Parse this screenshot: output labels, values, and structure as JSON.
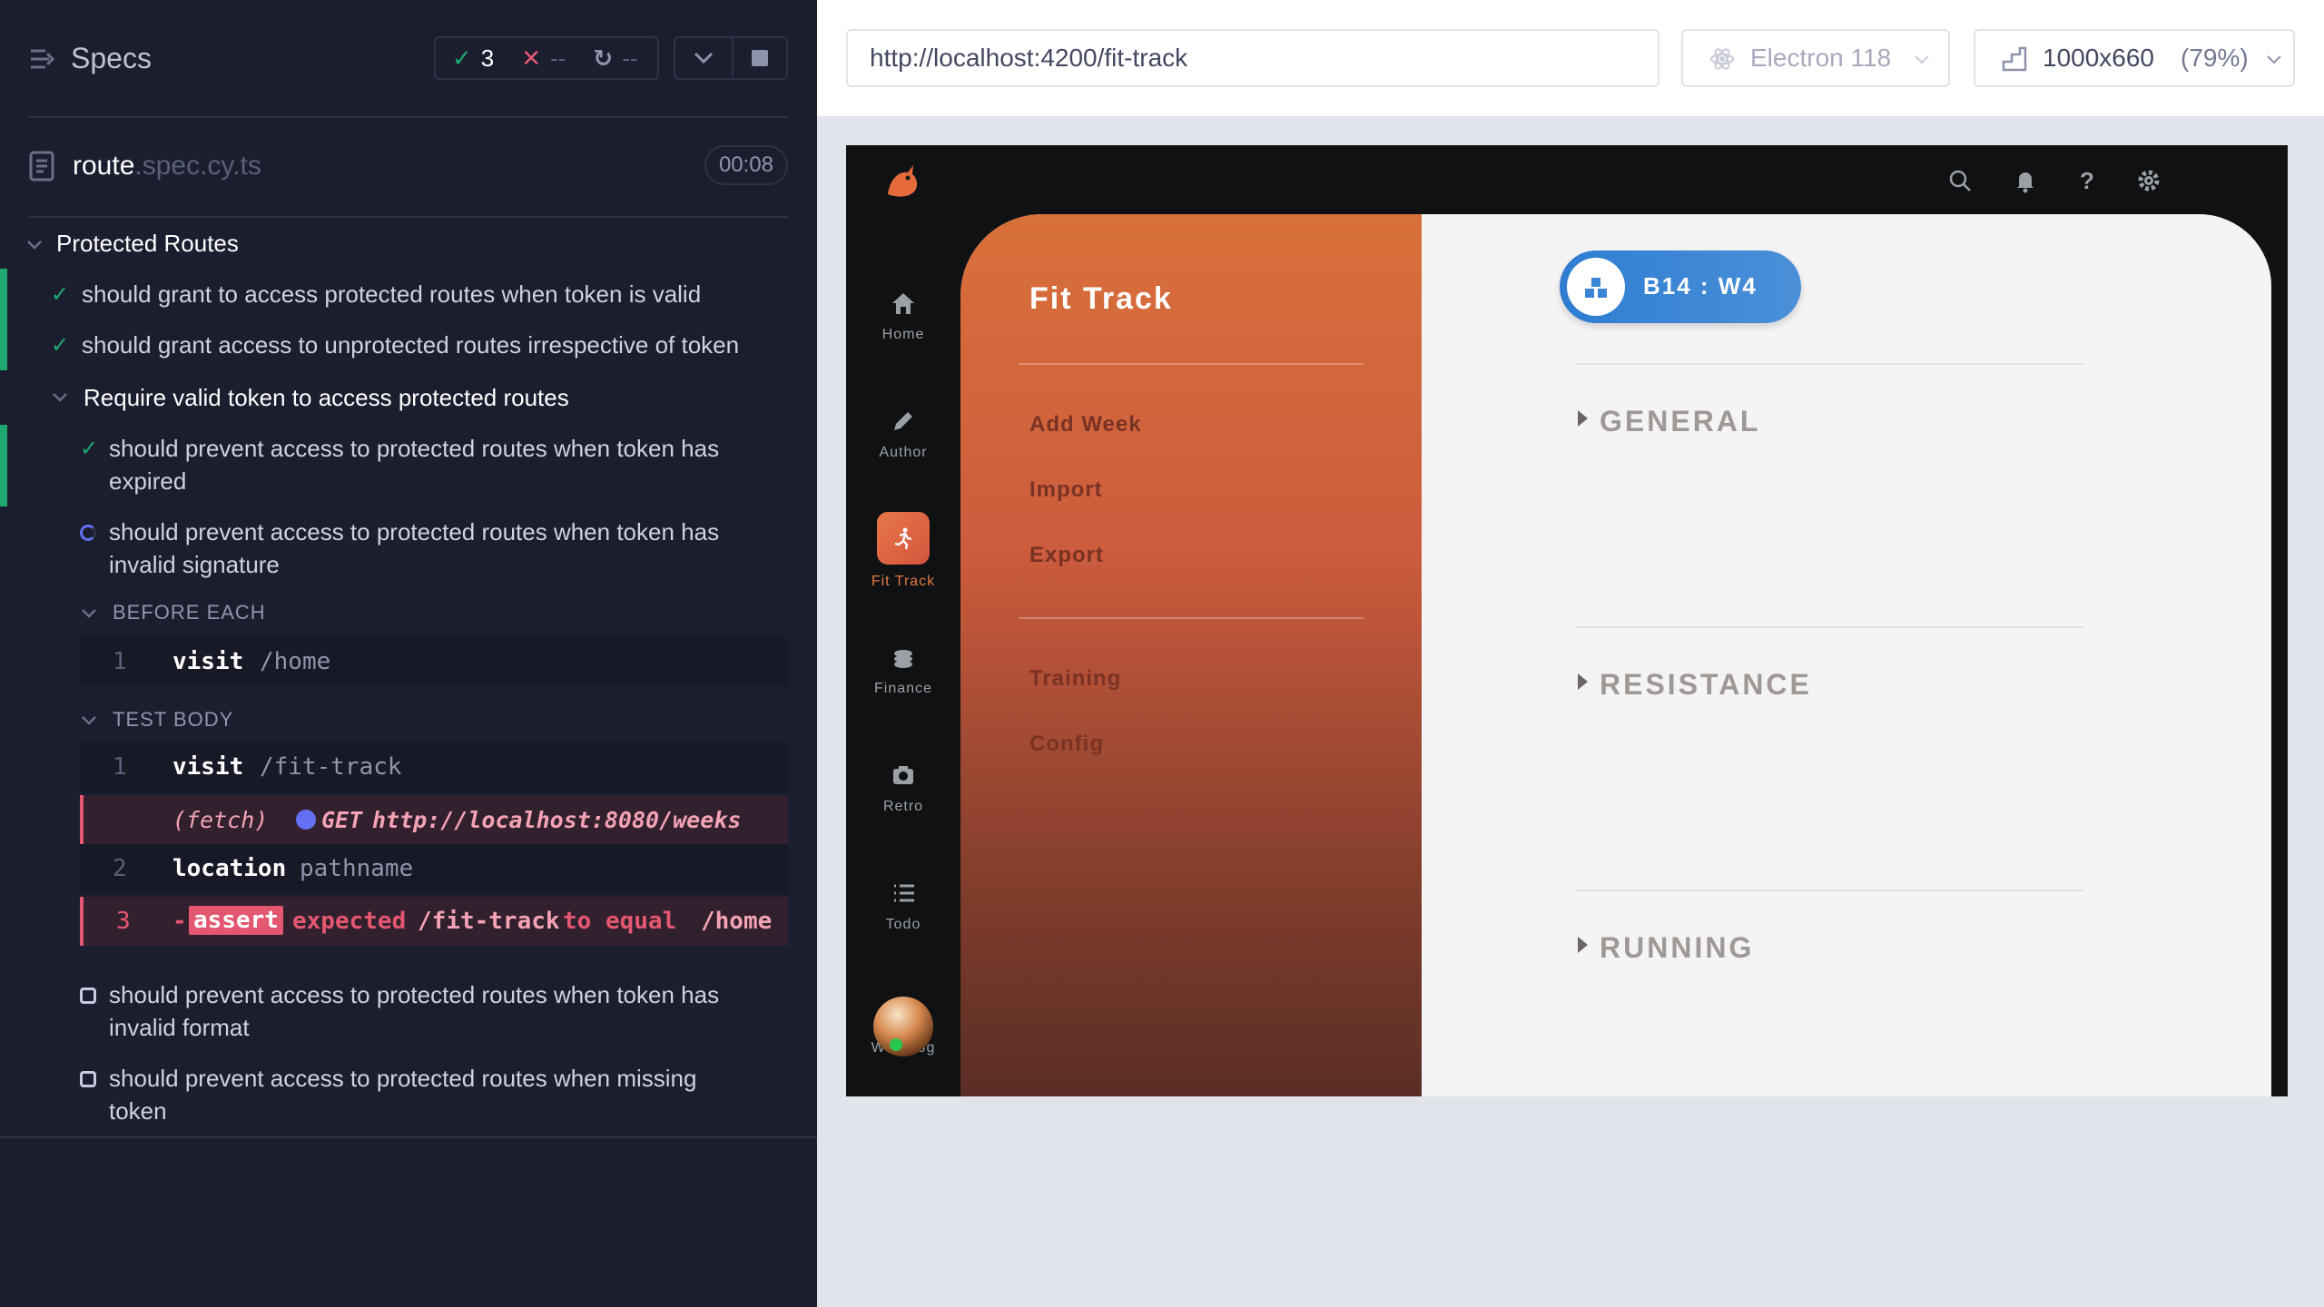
{
  "reporter": {
    "title": "Specs",
    "stats": {
      "passed": "3",
      "failed": "--",
      "pending": "--"
    },
    "file": {
      "name": "route",
      "ext": ".spec.cy.ts",
      "duration": "00:08"
    },
    "suite": {
      "title": "Protected Routes",
      "tests": [
        "should grant to access protected routes when token is valid",
        "should grant access to unprotected routes irrespective of token"
      ],
      "nested": {
        "title": "Require valid token to access protected routes",
        "test_expired_1": "should prevent access to protected routes when token has",
        "test_expired_2": "expired",
        "test_running_1": "should prevent access to protected routes when token has",
        "test_running_2": "invalid signature",
        "before_each": "BEFORE EACH",
        "before_cmd": {
          "num": "1",
          "name": "visit",
          "arg": "/home"
        },
        "test_body": "TEST BODY",
        "body_cmds": [
          {
            "num": "1",
            "name": "visit",
            "arg": "/fit-track"
          },
          {
            "num": "2",
            "name": "location",
            "arg": "pathname"
          }
        ],
        "fetch": {
          "label": "(fetch)",
          "method": "GET",
          "url": "http://localhost:8080/weeks"
        },
        "assert": {
          "num": "3",
          "dash": "-",
          "name": "assert",
          "w1": "expected",
          "w2": "/fit-track",
          "w3": "to equal",
          "w4": "/home"
        },
        "pending_a_1": "should prevent access to protected routes when token has",
        "pending_a_2": "invalid format",
        "pending_b_1": "should prevent access to protected routes when missing",
        "pending_b_2": "token"
      }
    }
  },
  "topbar": {
    "url": "http://localhost:4200/fit-track",
    "browser": "Electron 118",
    "viewport": "1000x660",
    "scale": "(79%)"
  },
  "app": {
    "nav": [
      {
        "label": "Home",
        "icon": "home-icon"
      },
      {
        "label": "Author",
        "icon": "pencil-icon"
      },
      {
        "label": "Fit Track",
        "icon": "running-icon"
      },
      {
        "label": "Finance",
        "icon": "coins-icon"
      },
      {
        "label": "Retro",
        "icon": "camera-icon"
      },
      {
        "label": "Todo",
        "icon": "list-icon"
      },
      {
        "label": "WorkLog",
        "icon": "avatar"
      }
    ],
    "panel_title": "Fit Track",
    "menu": [
      "Add Week",
      "Import",
      "Export",
      "Training",
      "Config"
    ],
    "week_pill": "B14 : W4",
    "sections": [
      "GENERAL",
      "RESISTANCE",
      "RUNNING"
    ],
    "colors": {
      "accent": "#e57a43",
      "pill": "#3a85d6",
      "pass": "#1fa971",
      "fail": "#e45770"
    }
  }
}
